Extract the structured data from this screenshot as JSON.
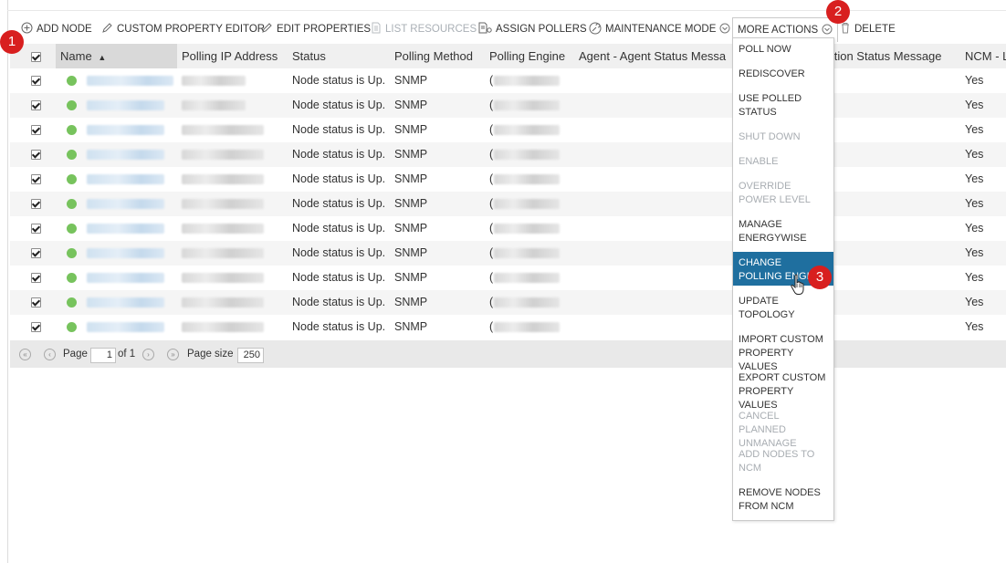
{
  "toolbar": {
    "add_node": "ADD NODE",
    "custom_property_editor": "CUSTOM PROPERTY EDITOR",
    "edit_properties": "EDIT PROPERTIES",
    "list_resources": "LIST RESOURCES",
    "assign_pollers": "ASSIGN POLLERS",
    "maintenance_mode": "MAINTENANCE MODE",
    "more_actions": "MORE ACTIONS",
    "delete": "DELETE"
  },
  "grid": {
    "columns": [
      "Name",
      "Polling IP Address",
      "Status",
      "Polling Method",
      "Polling Engine",
      "Agent - Agent Status Messa",
      "ection Status Message",
      "NCM - L"
    ],
    "sort_indicator": "▲",
    "row_status": "Node status is Up.",
    "row_method": "SNMP",
    "row_engine_prefix": "(",
    "row_ncm": "Yes",
    "row_count": 11
  },
  "pager": {
    "page_label": "Page",
    "page_value": "1",
    "of_label": "of 1",
    "page_size_label": "Page size",
    "page_size_value": "250"
  },
  "more_actions_menu": {
    "items": [
      {
        "label": "POLL NOW",
        "state": "enabled"
      },
      {
        "label": "REDISCOVER",
        "state": "enabled"
      },
      {
        "label": "USE POLLED STATUS",
        "state": "enabled"
      },
      {
        "label": "SHUT DOWN",
        "state": "disabled"
      },
      {
        "label": "ENABLE",
        "state": "disabled"
      },
      {
        "label": "OVERRIDE POWER LEVEL",
        "state": "disabled"
      },
      {
        "label": "MANAGE ENERGYWISE",
        "state": "enabled"
      },
      {
        "label": "CHANGE POLLING ENGINE",
        "state": "highlighted"
      },
      {
        "label": "UPDATE TOPOLOGY",
        "state": "enabled"
      },
      {
        "label": "IMPORT CUSTOM PROPERTY VALUES",
        "state": "enabled"
      },
      {
        "label": "EXPORT CUSTOM PROPERTY VALUES",
        "state": "enabled"
      },
      {
        "label": "CANCEL PLANNED UNMANAGE",
        "state": "disabled"
      },
      {
        "label": "ADD NODES TO NCM",
        "state": "disabled"
      },
      {
        "label": "REMOVE NODES FROM NCM",
        "state": "enabled"
      }
    ]
  },
  "callouts": {
    "one": "1",
    "two": "2",
    "three": "3"
  },
  "colors": {
    "status_up": "#77c35d",
    "menu_highlight": "#1f6f9f",
    "callout": "#d81f1f"
  }
}
